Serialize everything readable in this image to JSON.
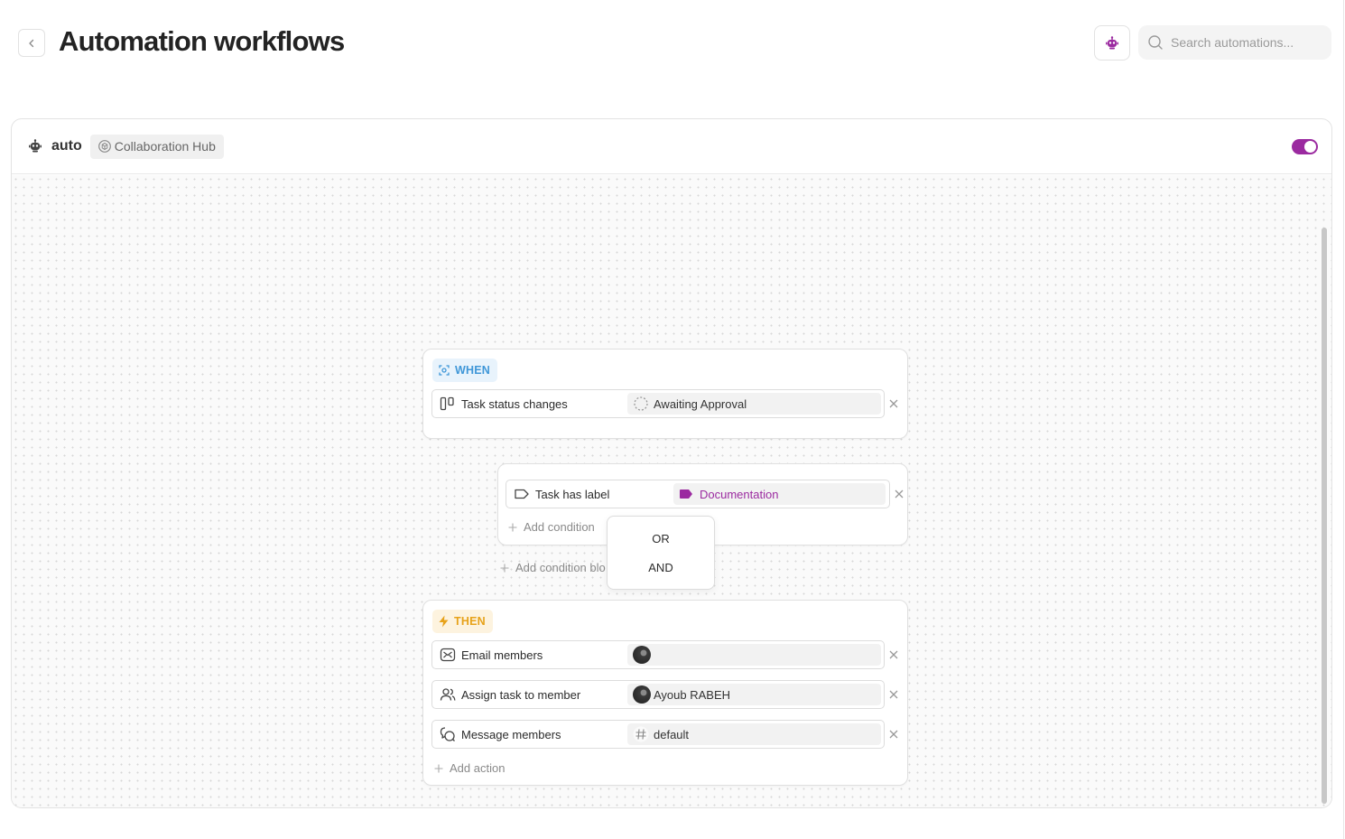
{
  "header": {
    "title": "Automation workflows",
    "search_placeholder": "Search automations..."
  },
  "automation": {
    "name": "auto",
    "hub": "Collaboration Hub",
    "enabled": true,
    "accent_color": "#9b2aa0"
  },
  "when_block": {
    "tag": "WHEN",
    "trigger": {
      "label": "Task status changes",
      "value": "Awaiting Approval"
    }
  },
  "condition_block": {
    "condition": {
      "label": "Task has label",
      "value": "Documentation",
      "label_color": "#9b2aa0"
    },
    "add_condition": "Add condition",
    "add_condition_block": "Add condition blo"
  },
  "operator_menu": {
    "options": [
      "OR",
      "AND"
    ]
  },
  "then_block": {
    "tag": "THEN",
    "actions": [
      {
        "label": "Email members",
        "value": ""
      },
      {
        "label": "Assign task to member",
        "value": "Ayoub RABEH"
      },
      {
        "label": "Message members",
        "value": "default"
      }
    ],
    "add_action": "Add action"
  },
  "colors": {
    "when": "#3f97d8",
    "then": "#e7a21a"
  }
}
